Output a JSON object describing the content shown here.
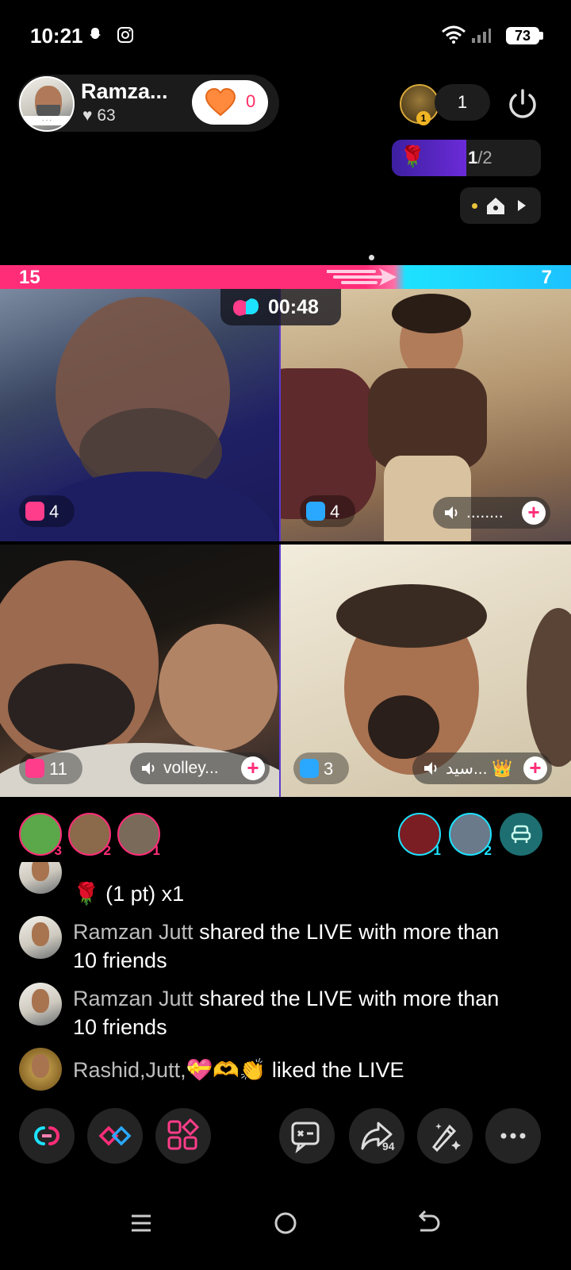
{
  "status_bar": {
    "time": "10:21",
    "battery": "73"
  },
  "host": {
    "name": "Ramza...",
    "likes": "63",
    "follow_count": "0"
  },
  "top_right": {
    "viewer_rank": "1",
    "viewer_count": "1",
    "rose_progress_done": "1",
    "rose_progress_total": "/2"
  },
  "battle": {
    "left_score": "15",
    "right_score": "7",
    "timer": "00:48",
    "score_fraction_left": 0.68
  },
  "cells": [
    {
      "gift_count": "4",
      "audio_label": ""
    },
    {
      "gift_count": "4",
      "audio_label": "........"
    },
    {
      "gift_count": "11",
      "audio_label": "volley..."
    },
    {
      "gift_count": "3",
      "audio_label": "سید... 👑"
    }
  ],
  "supporters_left": [
    {
      "rank": "3"
    },
    {
      "rank": "2"
    },
    {
      "rank": "1"
    }
  ],
  "supporters_right": [
    {
      "rank": "1"
    },
    {
      "rank": "2"
    }
  ],
  "chat": [
    {
      "user": "",
      "text": "🌹 (1 pt) x1"
    },
    {
      "user": "Ramzan Jutt",
      "text": " shared the LIVE with more than 10 friends"
    },
    {
      "user": "Ramzan Jutt",
      "text": " shared the LIVE with more than 10 friends"
    },
    {
      "user": "Rashid,Jutt,💝🫶👏",
      "text": " liked the LIVE"
    }
  ],
  "toolbar": {
    "share_count": "94"
  },
  "colors": {
    "left_team": "#ff2d78",
    "right_team": "#1de2ff",
    "accent": "#ff3d8a"
  }
}
